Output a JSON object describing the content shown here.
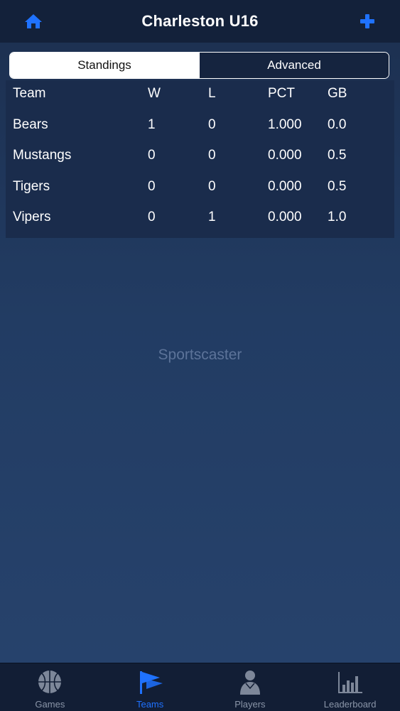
{
  "header": {
    "title": "Charleston U16",
    "home_icon": "home-icon",
    "add_icon": "plus-icon",
    "accent_color": "#1f72ff"
  },
  "segmented": {
    "options": [
      "Standings",
      "Advanced"
    ],
    "selected": "Standings"
  },
  "standings": {
    "columns": [
      "Team",
      "W",
      "L",
      "PCT",
      "GB"
    ],
    "rows": [
      {
        "team": "Bears",
        "w": "1",
        "l": "0",
        "pct": "1.000",
        "gb": "0.0"
      },
      {
        "team": "Mustangs",
        "w": "0",
        "l": "0",
        "pct": "0.000",
        "gb": "0.5"
      },
      {
        "team": "Tigers",
        "w": "0",
        "l": "0",
        "pct": "0.000",
        "gb": "0.5"
      },
      {
        "team": "Vipers",
        "w": "0",
        "l": "1",
        "pct": "0.000",
        "gb": "1.0"
      }
    ]
  },
  "watermark": "Sportscaster",
  "tabbar": {
    "items": [
      {
        "label": "Games",
        "icon": "basketball-icon",
        "active": false
      },
      {
        "label": "Teams",
        "icon": "pennant-icon",
        "active": true
      },
      {
        "label": "Players",
        "icon": "player-icon",
        "active": false
      },
      {
        "label": "Leaderboard",
        "icon": "bar-chart-icon",
        "active": false
      }
    ]
  }
}
